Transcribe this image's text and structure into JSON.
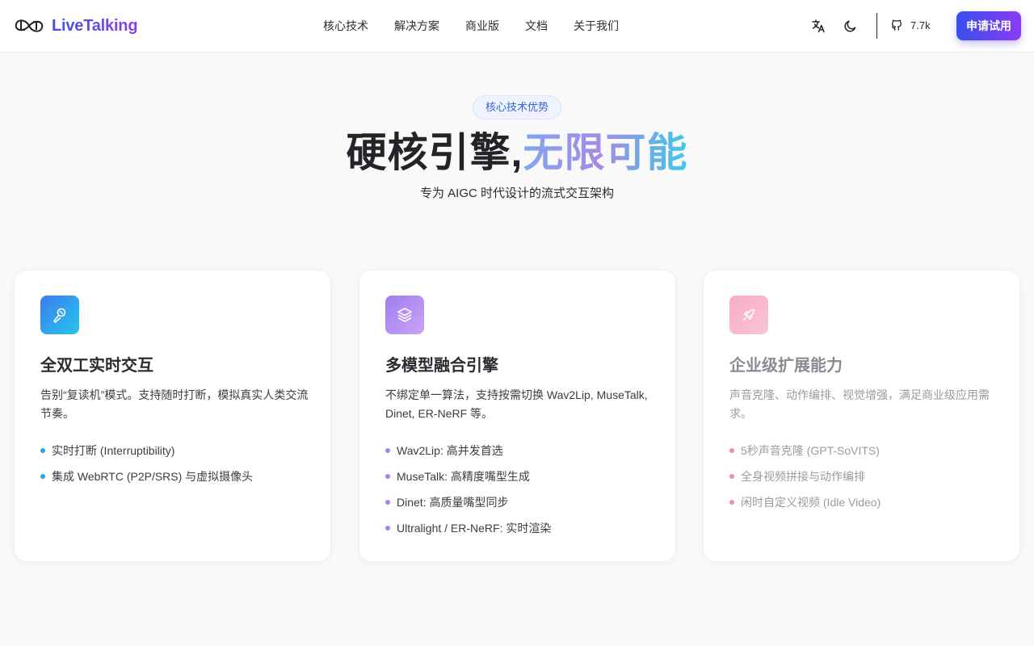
{
  "brand": {
    "name": "LiveTalking"
  },
  "nav": {
    "items": [
      {
        "label": "核心技术"
      },
      {
        "label": "解决方案"
      },
      {
        "label": "商业版"
      },
      {
        "label": "文档"
      },
      {
        "label": "关于我们"
      }
    ]
  },
  "header": {
    "translate_icon": "translate-icon",
    "theme_icon": "moon-icon",
    "github_icon": "github-icon",
    "github_stars": "7.7k",
    "cta_label": "申请试用"
  },
  "hero": {
    "badge": "核心技术优势",
    "title_plain": "硬核引擎,",
    "title_gradient": "无限可能",
    "subtitle": "专为 AIGC 时代设计的流式交互架构"
  },
  "colors": {
    "brand_start": "#3a4ef0",
    "brand_end": "#8a3cf2",
    "card1_dot": "#22a7e0",
    "card2_dot": "#b57cf0",
    "card3_dot": "#f08cb0"
  },
  "cards": [
    {
      "icon": "microphone-icon",
      "title": "全双工实时交互",
      "description": "告别“复读机”模式。支持随时打断，模拟真实人类交流节奏。",
      "points": [
        "实时打断 (Interruptibility)",
        "集成 WebRTC (P2P/SRS) 与虚拟摄像头"
      ]
    },
    {
      "icon": "layers-icon",
      "title": "多模型融合引擎",
      "description": "不绑定单一算法，支持按需切换 Wav2Lip, MuseTalk, Dinet, ER-NeRF 等。",
      "points": [
        "Wav2Lip: 高并发首选",
        "MuseTalk: 高精度嘴型生成",
        "Dinet: 高质量嘴型同步",
        "Ultralight / ER-NeRF: 实时渲染"
      ]
    },
    {
      "icon": "rocket-icon",
      "title": "企业级扩展能力",
      "description": "声音克隆、动作编排、视觉增强，满足商业级应用需求。",
      "points": [
        "5秒声音克隆 (GPT-SoVITS)",
        "全身视频拼接与动作编排",
        "闲时自定义视频 (Idle Video)"
      ]
    }
  ]
}
